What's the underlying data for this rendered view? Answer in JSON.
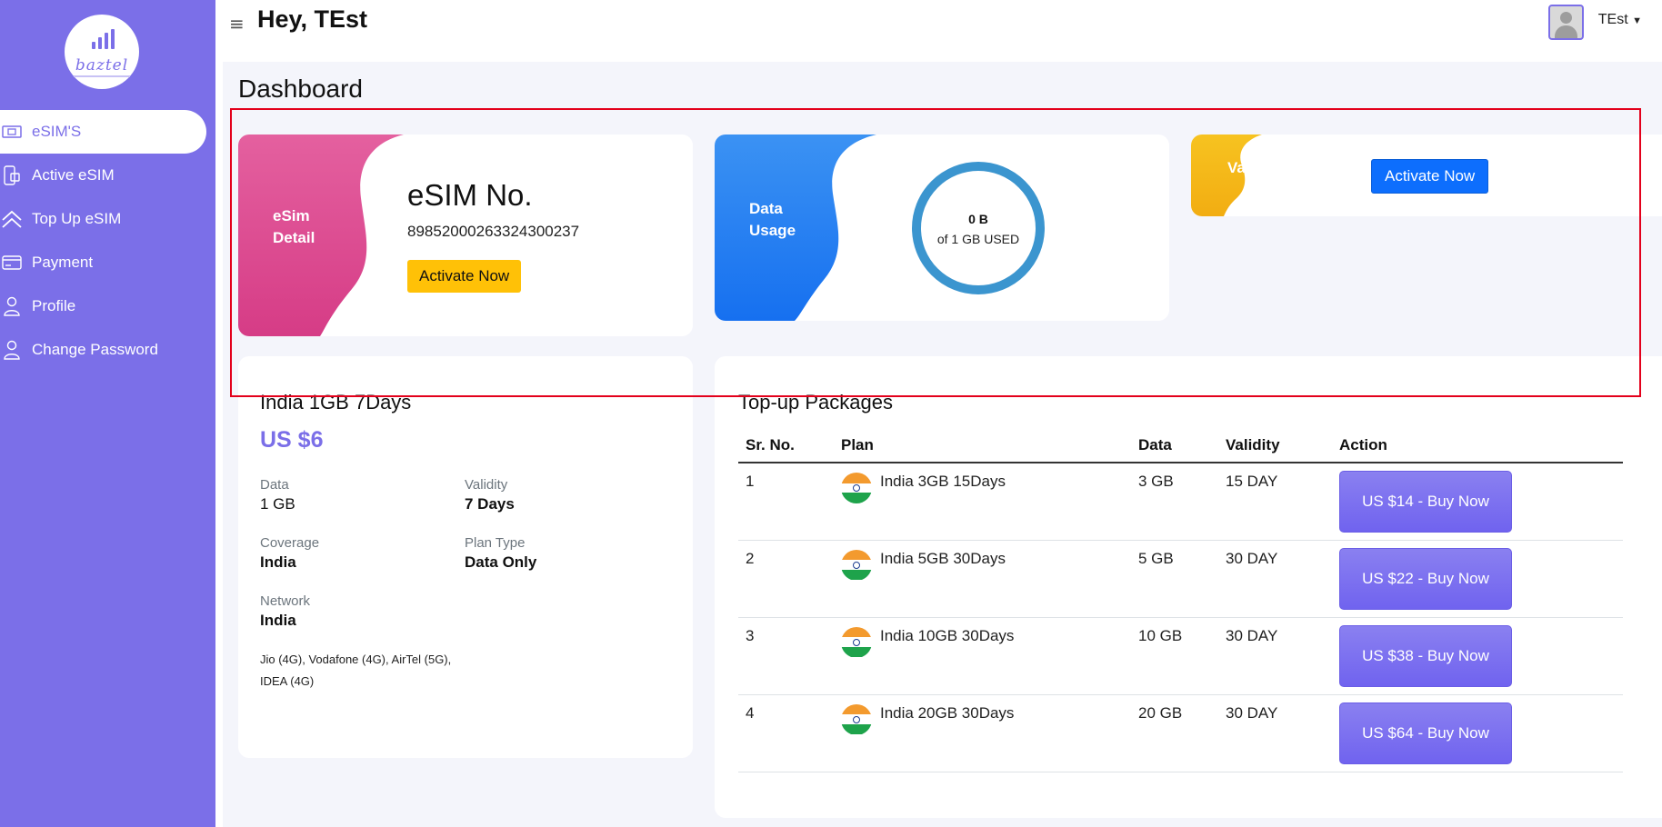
{
  "brand": {
    "logo_text": "baztel"
  },
  "sidebar": {
    "items": [
      {
        "label": "eSIM'S",
        "icon": "sim-card-icon",
        "active": true
      },
      {
        "label": "Active eSIM",
        "icon": "mobile-sim-icon"
      },
      {
        "label": "Top Up eSIM",
        "icon": "double-chevron-up-icon"
      },
      {
        "label": "Payment",
        "icon": "credit-card-icon"
      },
      {
        "label": "Profile",
        "icon": "user-icon"
      },
      {
        "label": "Change Password",
        "icon": "user-key-icon"
      }
    ]
  },
  "header": {
    "greeting": "Hey, TEst",
    "user_name": "TEst"
  },
  "page": {
    "title": "Dashboard"
  },
  "esim_card": {
    "label": "eSim Detail",
    "title": "eSIM No.",
    "number": "89852000263324300237",
    "button": "Activate Now"
  },
  "usage_card": {
    "label": "Data Usage",
    "used": "0 B",
    "of_text": "of 1 GB USED"
  },
  "validity_card": {
    "label": "Va",
    "button": "Activate Now"
  },
  "plan": {
    "name": "India 1GB 7Days",
    "price": "US $6",
    "data_label": "Data",
    "data_value": "1 GB",
    "validity_label": "Validity",
    "validity_value": "7 Days",
    "coverage_label": "Coverage",
    "coverage_value": "India",
    "plantype_label": "Plan Type",
    "plantype_value": "Data Only",
    "network_label": "Network",
    "network_value": "India",
    "networks": "Jio (4G), Vodafone (4G), AirTel (5G), IDEA (4G)"
  },
  "packages": {
    "title": "Top-up Packages",
    "headers": [
      "Sr. No.",
      "Plan",
      "Data",
      "Validity",
      "Action"
    ],
    "rows": [
      {
        "sr": "1",
        "plan": "India 3GB 15Days",
        "data": "3 GB",
        "validity": "15 DAY",
        "action": "US $14 - Buy Now"
      },
      {
        "sr": "2",
        "plan": "India 5GB 30Days",
        "data": "5 GB",
        "validity": "30 DAY",
        "action": "US $22 - Buy Now"
      },
      {
        "sr": "3",
        "plan": "India 10GB 30Days",
        "data": "10 GB",
        "validity": "30 DAY",
        "action": "US $38 - Buy Now"
      },
      {
        "sr": "4",
        "plan": "India 20GB 30Days",
        "data": "20 GB",
        "validity": "30 DAY",
        "action": "US $64 - Buy Now"
      }
    ]
  },
  "colors": {
    "sidebar": "#7b6fe8",
    "accent": "#7b6fe8",
    "esim_blob": "#e0559a",
    "usage_blob": "#2f8ff5",
    "validity_blob": "#f5b81a",
    "ring": "#3b95cf",
    "highlight": "#e3001b"
  }
}
